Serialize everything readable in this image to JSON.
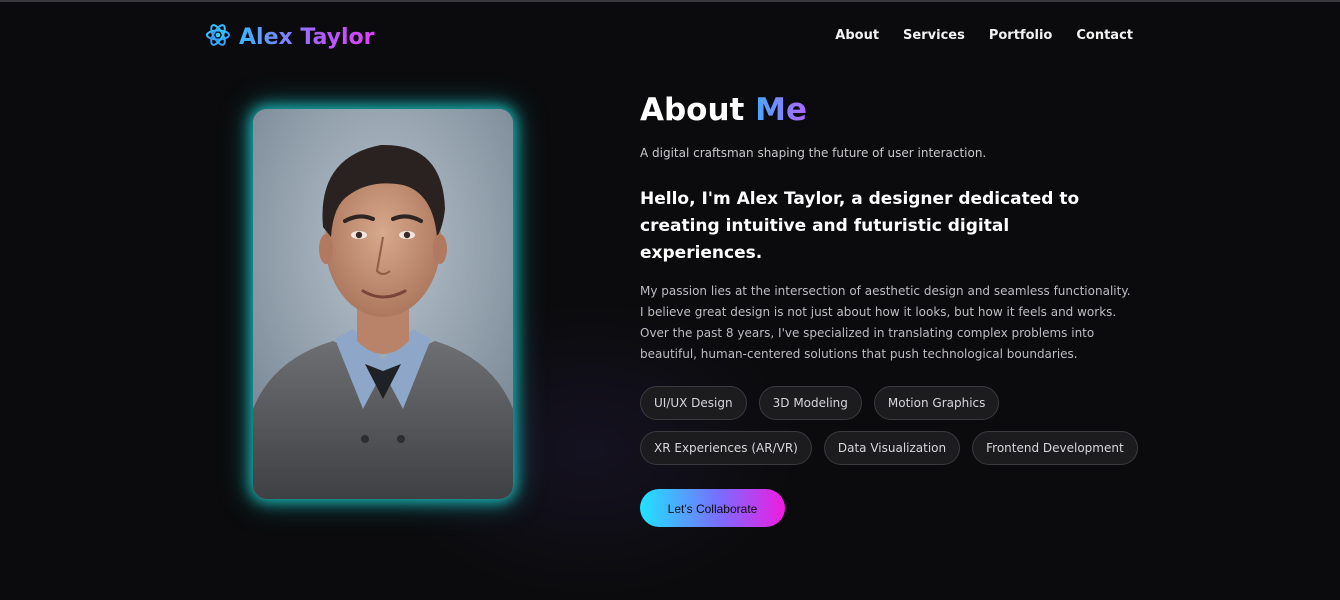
{
  "header": {
    "logo_icon": "atom-icon",
    "name": "Alex Taylor",
    "nav": [
      "About",
      "Services",
      "Portfolio",
      "Contact"
    ]
  },
  "about": {
    "title_main": "About",
    "title_accent": "Me",
    "tagline": "A digital craftsman shaping the future of user interaction.",
    "intro": "Hello, I'm Alex Taylor, a designer dedicated to creating intuitive and futuristic digital experiences.",
    "body": "My passion lies at the intersection of aesthetic design and seamless functionality. I believe great design is not just about how it looks, but how it feels and works. Over the past 8 years, I've specialized in translating complex problems into beautiful, human-centered solutions that push technological boundaries.",
    "skills": [
      "UI/UX Design",
      "3D Modeling",
      "Motion Graphics",
      "XR Experiences (AR/VR)",
      "Data Visualization",
      "Frontend Development"
    ],
    "cta": "Let's Collaborate"
  },
  "colors": {
    "background": "#0b0b0d",
    "glow": "#1edcdc",
    "gradient_start": "#1fe3ff",
    "gradient_end": "#f01be0"
  }
}
